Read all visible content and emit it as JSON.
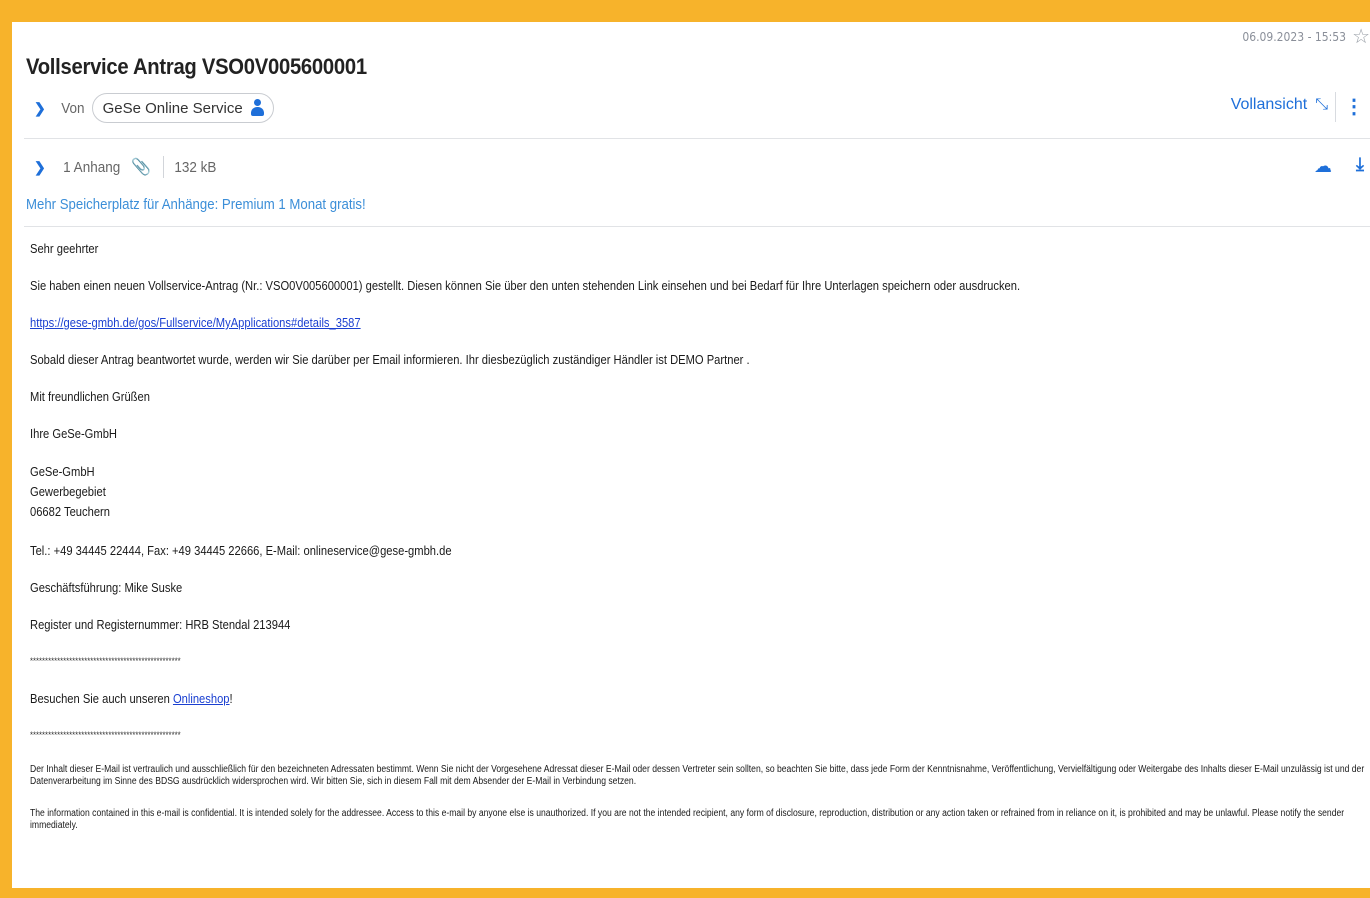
{
  "header": {
    "date": "06.09.2023 - 15:53",
    "subject": "Vollservice Antrag VSO0V005600001",
    "from_label": "Von",
    "sender": "GeSe Online Service",
    "fullview_label": "Vollansicht"
  },
  "attachment": {
    "count_label": "1 Anhang",
    "size": "132 kB"
  },
  "promo": "Mehr Speicherplatz für Anhänge: Premium 1 Monat gratis!",
  "body": {
    "greeting": "Sehr geehrter",
    "intro": "Sie haben einen neuen Vollservice-Antrag (Nr.: VSO0V005600001) gestellt. Diesen können Sie über den unten stehenden Link einsehen und bei Bedarf für Ihre Unterlagen speichern oder ausdrucken.",
    "link": "https://gese-gmbh.de/gos/Fullservice/MyApplications#details_3587",
    "notice": "Sobald dieser Antrag beantwortet wurde, werden wir Sie darüber per Email informieren. Ihr diesbezüglich zuständiger Händler ist DEMO Partner .",
    "closing": "Mit freundlichen Grüßen",
    "signature": "Ihre GeSe-GmbH",
    "company": "GeSe-GmbH",
    "street": "Gewerbegebiet",
    "city": "06682 Teuchern",
    "contact": "Tel.: +49 34445 22444, Fax: +49 34445 22666, E-Mail: onlineservice@gese-gmbh.de",
    "management": "Geschäftsführung: Mike Suske",
    "register": "Register und Registernummer:  HRB Stendal 213944",
    "separator": "**************************************************",
    "shop_prefix": "Besuchen Sie auch unseren ",
    "shop_link": "Onlineshop",
    "shop_suffix": "!",
    "disclaimer_de": "Der Inhalt dieser E-Mail ist vertraulich und ausschließlich für den bezeichneten Adressaten bestimmt. Wenn Sie nicht der Vorgesehene Adressat dieser E-Mail oder dessen Vertreter sein sollten, so beachten Sie bitte, dass jede Form der Kenntnisnahme, Veröffentlichung, Vervielfältigung oder Weitergabe des Inhalts dieser E-Mail unzulässig ist und der Datenverarbeitung im Sinne des BDSG ausdrücklich widersprochen wird. Wir bitten Sie, sich in diesem Fall mit dem Absender der E-Mail in Verbindung setzen.",
    "disclaimer_en": "The information contained in this e-mail is confidential. It is intended solely for the addressee. Access to this e-mail by anyone else is unauthorized. If you are not the intended recipient, any form of disclosure, reproduction, distribution or any action taken or refrained from in reliance on it, is prohibited and may be unlawful. Please notify the sender immediately."
  },
  "colors": {
    "frame": "#f7b32b",
    "accent": "#1e6fd9",
    "link": "#1a3fd1"
  }
}
